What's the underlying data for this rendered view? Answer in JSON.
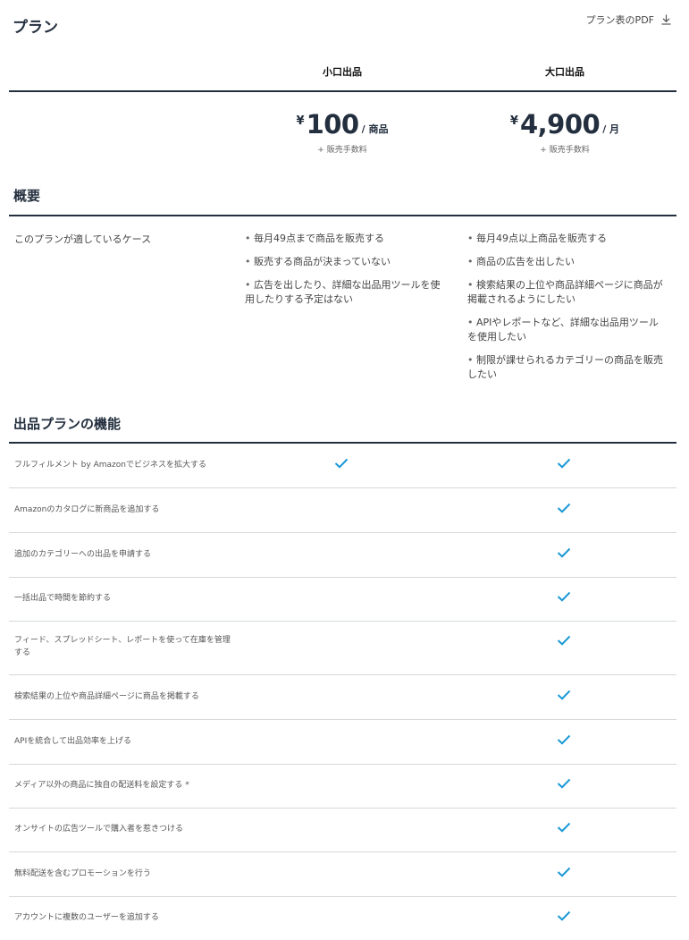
{
  "header": {
    "title": "プラン",
    "pdf_link": "プラン表のPDF",
    "pdf_icon": "download-icon"
  },
  "plans": [
    {
      "name": "小口出品",
      "currency": "¥",
      "amount": "100",
      "unit": "/ 商品",
      "fee": "+ 販売手数料"
    },
    {
      "name": "大口出品",
      "currency": "¥",
      "amount": "4,900",
      "unit": "/ 月",
      "fee": "+ 販売手数料"
    }
  ],
  "overview": {
    "title": "概要",
    "label": "このプランが適しているケース",
    "small_bullets": [
      "毎月49点まで商品を販売する",
      "販売する商品が決まっていない",
      "広告を出したり、詳細な出品用ツールを使用したりする予定はない"
    ],
    "large_bullets": [
      "毎月49点以上商品を販売する",
      "商品の広告を出したい",
      "検索結果の上位や商品詳細ページに商品が掲載されるようにしたい",
      "APIやレポートなど、詳細な出品用ツールを使用したい",
      "制限が課せられるカテゴリーの商品を販売したい"
    ]
  },
  "features": {
    "title": "出品プランの機能",
    "check_color": "#1a98d5",
    "check_icon": "checkmark-icon",
    "rows": [
      {
        "label": "フルフィルメント by Amazonでビジネスを拡大する",
        "small": true,
        "large": true
      },
      {
        "label": "Amazonのカタログに新商品を追加する",
        "small": false,
        "large": true
      },
      {
        "label": "追加のカテゴリーへの出品を申請する",
        "small": false,
        "large": true
      },
      {
        "label": "一括出品で時間を節約する",
        "small": false,
        "large": true
      },
      {
        "label": "フィード、スプレッドシート、レポートを使って在庫を管理する",
        "small": false,
        "large": true
      },
      {
        "label": "検索結果の上位や商品詳細ページに商品を掲載する",
        "small": false,
        "large": true
      },
      {
        "label": "APIを統合して出品効率を上げる",
        "small": false,
        "large": true
      },
      {
        "label": "メディア以外の商品に独自の配送料を設定する *",
        "small": false,
        "large": true
      },
      {
        "label": "オンサイトの広告ツールで購入者を惹きつける",
        "small": false,
        "large": true
      },
      {
        "label": "無料配送を含むプロモーションを行う",
        "small": false,
        "large": true
      },
      {
        "label": "アカウントに複数のユーザーを追加する",
        "small": false,
        "large": true
      }
    ]
  }
}
